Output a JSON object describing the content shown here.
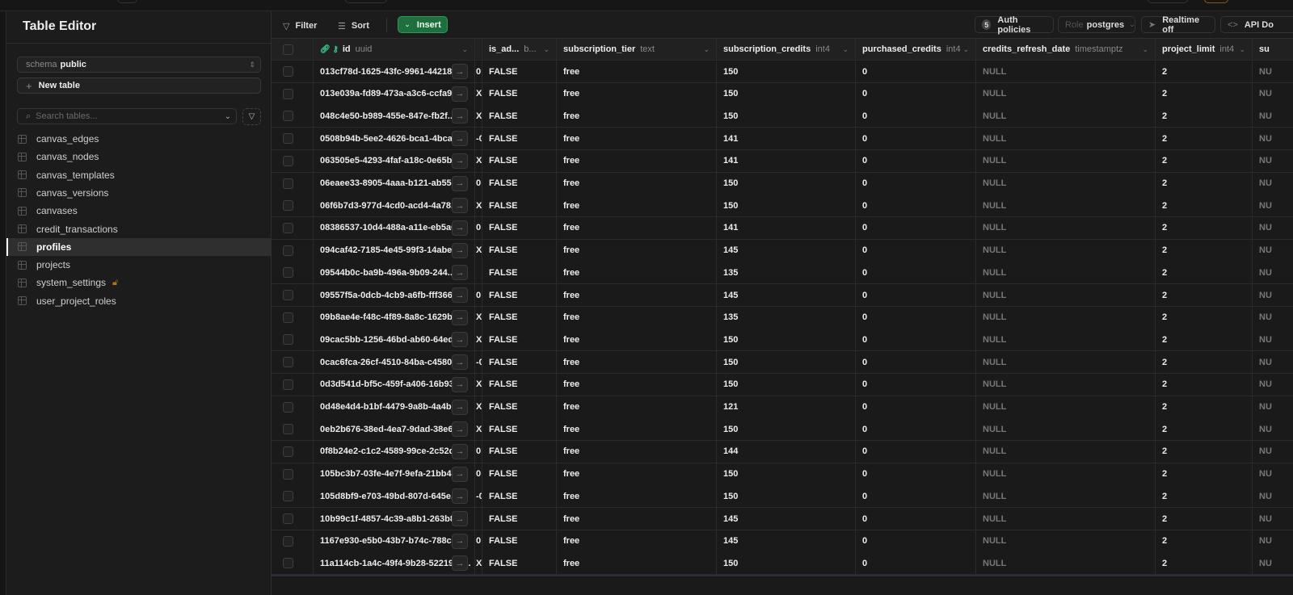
{
  "sidebar": {
    "title": "Table Editor",
    "schema_label": "schema",
    "schema_value": "public",
    "new_table": "New table",
    "search_placeholder": "Search tables...",
    "tables": [
      {
        "name": "canvas_edges"
      },
      {
        "name": "canvas_nodes"
      },
      {
        "name": "canvas_templates"
      },
      {
        "name": "canvas_versions"
      },
      {
        "name": "canvases"
      },
      {
        "name": "credit_transactions"
      },
      {
        "name": "profiles",
        "active": true
      },
      {
        "name": "projects"
      },
      {
        "name": "system_settings",
        "locked": true
      },
      {
        "name": "user_project_roles"
      }
    ]
  },
  "toolbar": {
    "filter": "Filter",
    "sort": "Sort",
    "insert": "Insert",
    "auth_count": "5",
    "auth_policies": "Auth policies",
    "role_label": "Role",
    "role_value": "postgres",
    "realtime": "Realtime off",
    "api_docs": "API Do"
  },
  "colors": {
    "accent": "#1f6e3e",
    "lock": "#b5721c",
    "key": "#3ecf8e"
  },
  "grid": {
    "columns": [
      {
        "name": "id",
        "type": "uuid"
      },
      {
        "name": "",
        "type": ""
      },
      {
        "name": "is_ad...",
        "type": "b..."
      },
      {
        "name": "subscription_tier",
        "type": "text"
      },
      {
        "name": "subscription_credits",
        "type": "int4"
      },
      {
        "name": "purchased_credits",
        "type": "int4"
      },
      {
        "name": "credits_refresh_date",
        "type": "timestamptz"
      },
      {
        "name": "project_limit",
        "type": "int4"
      },
      {
        "name": "su",
        "type": ""
      }
    ],
    "rows": [
      [
        "013cf78d-1625-43fc-9961-442189...",
        "0",
        "FALSE",
        "free",
        "150",
        "0",
        "NULL",
        "2",
        "NU"
      ],
      [
        "013e039a-fd89-473a-a3c6-ccfa9...",
        "X",
        "FALSE",
        "free",
        "150",
        "0",
        "NULL",
        "2",
        "NU"
      ],
      [
        "048c4e50-b989-455e-847e-fb2f...",
        "X",
        "FALSE",
        "free",
        "150",
        "0",
        "NULL",
        "2",
        "NU"
      ],
      [
        "0508b94b-5ee2-4626-bca1-4bca...",
        "-0",
        "FALSE",
        "free",
        "141",
        "0",
        "NULL",
        "2",
        "NU"
      ],
      [
        "063505e5-4293-4faf-a18c-0e65b...",
        "X",
        "FALSE",
        "free",
        "141",
        "0",
        "NULL",
        "2",
        "NU"
      ],
      [
        "06eaee33-8905-4aaa-b121-ab552...",
        "0",
        "FALSE",
        "free",
        "150",
        "0",
        "NULL",
        "2",
        "NU"
      ],
      [
        "06f6b7d3-977d-4cd0-acd4-4a78...",
        "X",
        "FALSE",
        "free",
        "150",
        "0",
        "NULL",
        "2",
        "NU"
      ],
      [
        "08386537-10d4-488a-a11e-eb5a6...",
        "0",
        "FALSE",
        "free",
        "141",
        "0",
        "NULL",
        "2",
        "NU"
      ],
      [
        "094caf42-7185-4e45-99f3-14abee...",
        "X",
        "FALSE",
        "free",
        "145",
        "0",
        "NULL",
        "2",
        "NU"
      ],
      [
        "09544b0c-ba9b-496a-9b09-244...",
        "",
        "FALSE",
        "free",
        "135",
        "0",
        "NULL",
        "2",
        "NU"
      ],
      [
        "09557f5a-0dcb-4cb9-a6fb-fff366...",
        "0",
        "FALSE",
        "free",
        "145",
        "0",
        "NULL",
        "2",
        "NU"
      ],
      [
        "09b8ae4e-f48c-4f89-8a8c-1629b...",
        "X",
        "FALSE",
        "free",
        "135",
        "0",
        "NULL",
        "2",
        "NU"
      ],
      [
        "09cac5bb-1256-46bd-ab60-64ed...",
        "X",
        "FALSE",
        "free",
        "150",
        "0",
        "NULL",
        "2",
        "NU"
      ],
      [
        "0cac6fca-26cf-4510-84ba-c4580...",
        "-0",
        "FALSE",
        "free",
        "150",
        "0",
        "NULL",
        "2",
        "NU"
      ],
      [
        "0d3d541d-bf5c-459f-a406-16b93...",
        "X",
        "FALSE",
        "free",
        "150",
        "0",
        "NULL",
        "2",
        "NU"
      ],
      [
        "0d48e4d4-b1bf-4479-9a8b-4a4b...",
        "X",
        "FALSE",
        "free",
        "121",
        "0",
        "NULL",
        "2",
        "NU"
      ],
      [
        "0eb2b676-38ed-4ea7-9dad-38e6...",
        "X",
        "FALSE",
        "free",
        "150",
        "0",
        "NULL",
        "2",
        "NU"
      ],
      [
        "0f8b24e2-c1c2-4589-99ce-2c52d...",
        "0",
        "FALSE",
        "free",
        "144",
        "0",
        "NULL",
        "2",
        "NU"
      ],
      [
        "105bc3b7-03fe-4e7f-9efa-21bb40...",
        "0",
        "FALSE",
        "free",
        "150",
        "0",
        "NULL",
        "2",
        "NU"
      ],
      [
        "105d8bf9-e703-49bd-807d-645e...",
        "-0",
        "FALSE",
        "free",
        "150",
        "0",
        "NULL",
        "2",
        "NU"
      ],
      [
        "10b99c1f-4857-4c39-a8b1-263b8...",
        "",
        "FALSE",
        "free",
        "145",
        "0",
        "NULL",
        "2",
        "NU"
      ],
      [
        "1167e930-e5b0-43b7-b74c-788c9...",
        "0",
        "FALSE",
        "free",
        "145",
        "0",
        "NULL",
        "2",
        "NU"
      ],
      [
        "11a114cb-1a4c-49f4-9b28-52219ec...",
        "X",
        "FALSE",
        "free",
        "150",
        "0",
        "NULL",
        "2",
        "NU"
      ]
    ]
  }
}
